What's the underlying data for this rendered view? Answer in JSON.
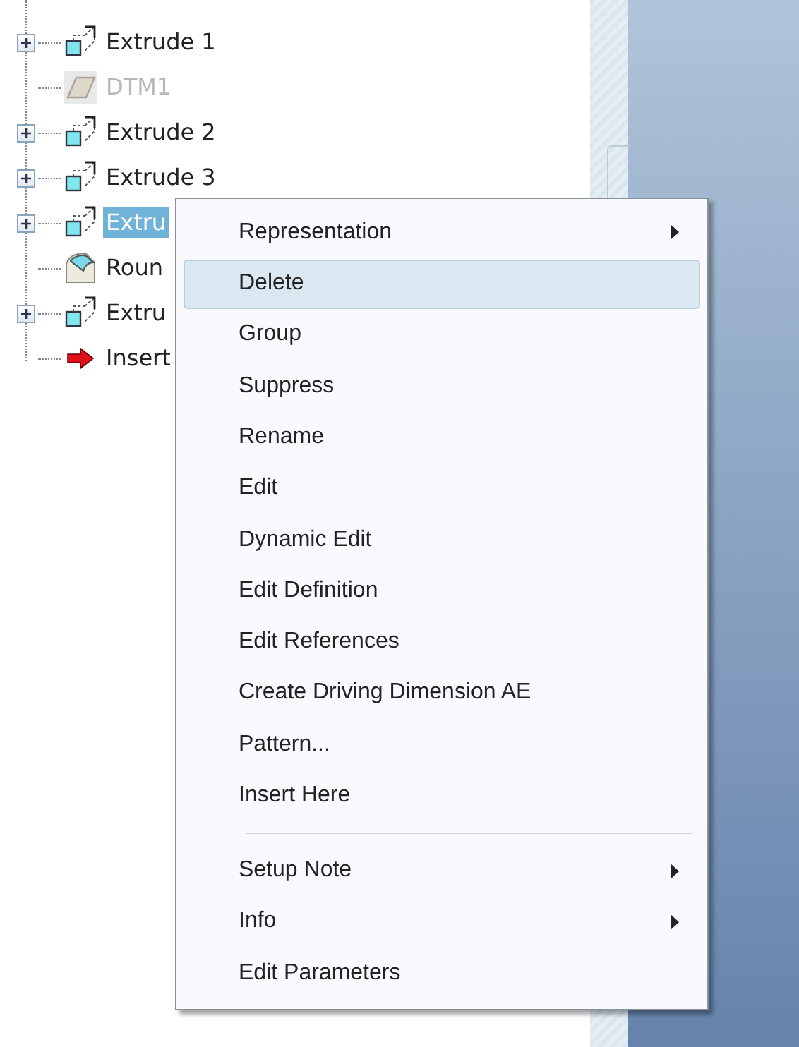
{
  "model_tree": {
    "items": [
      {
        "label": "Extrude 1",
        "kind": "extrude",
        "expandable": true,
        "selected": false,
        "disabled": false
      },
      {
        "label": "DTM1",
        "kind": "datum",
        "expandable": false,
        "selected": false,
        "disabled": true
      },
      {
        "label": "Extrude 2",
        "kind": "extrude",
        "expandable": true,
        "selected": false,
        "disabled": false
      },
      {
        "label": "Extrude 3",
        "kind": "extrude",
        "expandable": true,
        "selected": false,
        "disabled": false
      },
      {
        "label": "Extru",
        "kind": "extrude",
        "expandable": true,
        "selected": true,
        "disabled": false
      },
      {
        "label": "Roun",
        "kind": "round",
        "expandable": false,
        "selected": false,
        "disabled": false
      },
      {
        "label": "Extru",
        "kind": "extrude",
        "expandable": true,
        "selected": false,
        "disabled": false
      },
      {
        "label": "Insert",
        "kind": "insert",
        "expandable": false,
        "selected": false,
        "disabled": false
      }
    ]
  },
  "context_menu": {
    "items": [
      {
        "label": "Representation",
        "submenu": true,
        "selected": false
      },
      {
        "label": "Delete",
        "submenu": false,
        "selected": true
      },
      {
        "label": "Group",
        "submenu": false,
        "selected": false
      },
      {
        "label": "Suppress",
        "submenu": false,
        "selected": false
      },
      {
        "label": "Rename",
        "submenu": false,
        "selected": false
      },
      {
        "label": "Edit",
        "submenu": false,
        "selected": false
      },
      {
        "label": "Dynamic Edit",
        "submenu": false,
        "selected": false
      },
      {
        "label": "Edit Definition",
        "submenu": false,
        "selected": false
      },
      {
        "label": "Edit References",
        "submenu": false,
        "selected": false
      },
      {
        "label": "Create Driving Dimension AE",
        "submenu": false,
        "selected": false
      },
      {
        "label": "Pattern...",
        "submenu": false,
        "selected": false
      },
      {
        "label": "Insert Here",
        "submenu": false,
        "selected": false
      },
      {
        "label": "Setup Note",
        "submenu": true,
        "selected": false,
        "separator_before": true
      },
      {
        "label": "Info",
        "submenu": true,
        "selected": false
      },
      {
        "label": "Edit Parameters",
        "submenu": false,
        "selected": false
      }
    ]
  }
}
